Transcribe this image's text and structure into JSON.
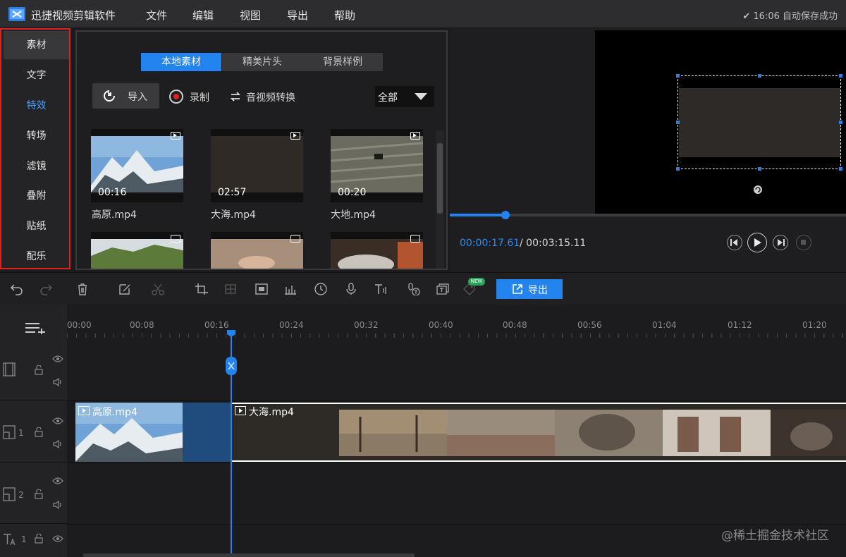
{
  "app": {
    "title": "迅捷视频剪辑软件",
    "autosave": "✔ 16:06 自动保存成功"
  },
  "menu": {
    "items": [
      "文件",
      "编辑",
      "视图",
      "导出",
      "帮助"
    ]
  },
  "sidebar": {
    "items": [
      {
        "label": "素材"
      },
      {
        "label": "文字"
      },
      {
        "label": "特效"
      },
      {
        "label": "转场"
      },
      {
        "label": "滤镜"
      },
      {
        "label": "叠附"
      },
      {
        "label": "贴纸"
      },
      {
        "label": "配乐"
      }
    ]
  },
  "media": {
    "tabs": [
      "本地素材",
      "精美片头",
      "背景样例"
    ],
    "import_label": "导入",
    "record_label": "录制",
    "convert_label": "音视频转换",
    "filter_value": "全部",
    "items": [
      {
        "name": "高原.mp4",
        "duration": "00:16"
      },
      {
        "name": "大海.mp4",
        "duration": "02:57"
      },
      {
        "name": "大地.mp4",
        "duration": "00:20"
      }
    ]
  },
  "preview": {
    "current_time": "00:00:17.61",
    "total_time": "/ 00:03:15.11",
    "progress": 0.09
  },
  "toolbar": {
    "export_label": "导出",
    "new_badge": "NEW"
  },
  "timeline": {
    "ticks": [
      "00:00",
      "00:08",
      "00:16",
      "00:24",
      "00:32",
      "00:40",
      "00:48",
      "00:56",
      "01:04",
      "01:12",
      "01:20"
    ],
    "tracks": [
      {
        "number": ""
      },
      {
        "number": "1"
      },
      {
        "number": "2"
      },
      {
        "number": "1"
      }
    ],
    "clips": [
      {
        "label": "高原.mp4"
      },
      {
        "label": "大海.mp4"
      }
    ]
  },
  "watermark": "@稀土掘金技术社区",
  "colors": {
    "accent": "#2384f0",
    "highlight_border": "#e0211f",
    "active_text": "#4a9ff5"
  }
}
